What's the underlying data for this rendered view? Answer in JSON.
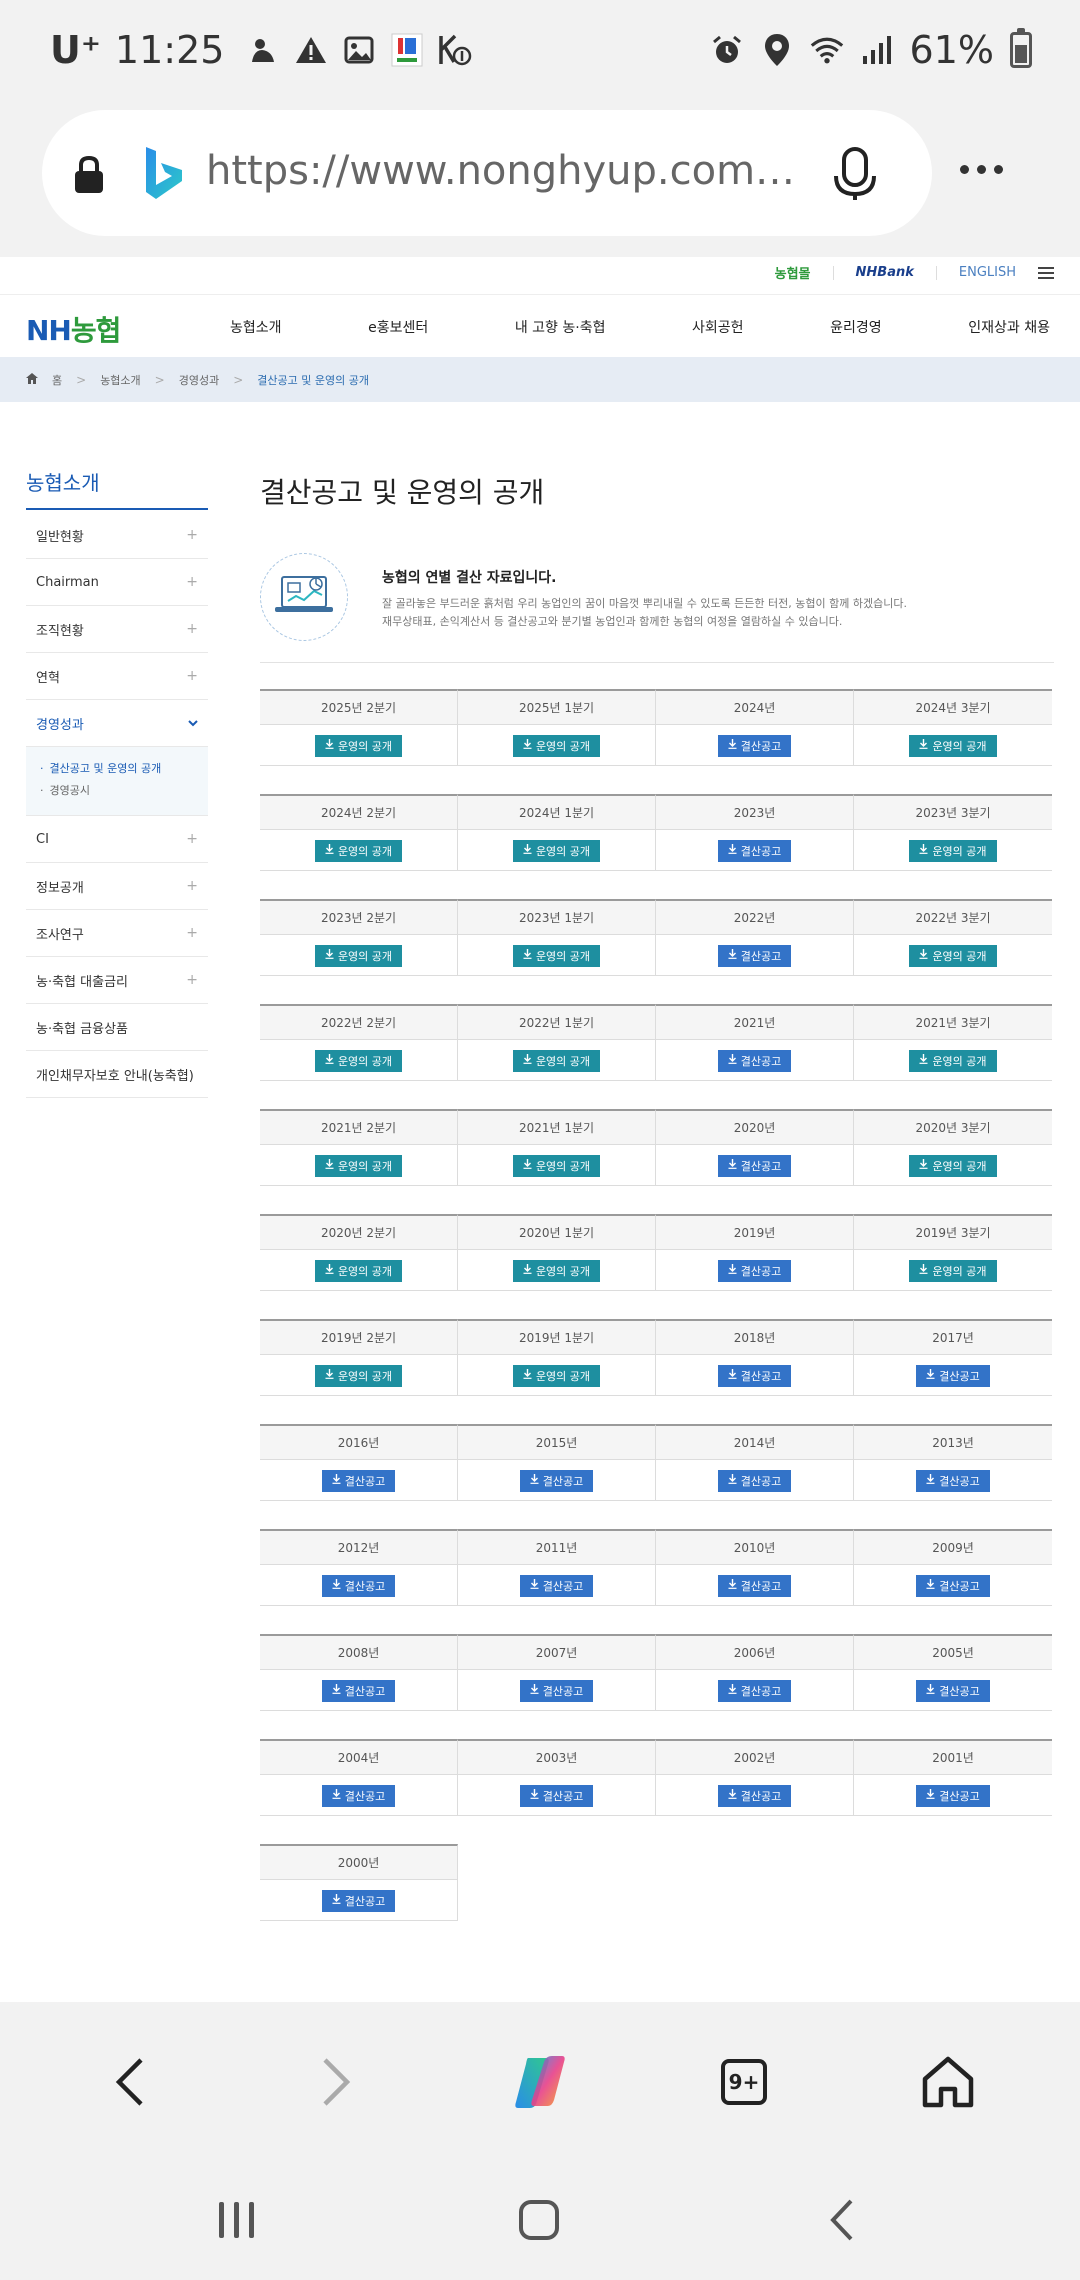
{
  "status_bar": {
    "carrier": "U⁺",
    "time": "11:25",
    "battery": "61%",
    "battery_level": 0.61
  },
  "browser": {
    "url": "https://www.nonghyup.com/intro…",
    "tabs_count": "9+"
  },
  "header": {
    "logo_nh": "NH",
    "logo_ko": "농협",
    "top_links": [
      "농협몰",
      "NHBank",
      "ENGLISH"
    ],
    "menu": [
      "농협소개",
      "e홍보센터",
      "내 고향 농·축협",
      "사회공헌",
      "윤리경영",
      "인재상과 채용"
    ]
  },
  "breadcrumb": {
    "home": "홈",
    "items": [
      "농협소개",
      "경영성과",
      "결산공고 및 운영의 공개"
    ]
  },
  "lnb": {
    "title": "농협소개",
    "items_top": [
      {
        "label": "일반현황"
      },
      {
        "label": "Chairman"
      },
      {
        "label": "조직현황"
      },
      {
        "label": "연혁"
      }
    ],
    "active": {
      "label": "경영성과"
    },
    "sub": [
      "결산공고 및 운영의 공개",
      "경영공시"
    ],
    "items_bottom": [
      {
        "label": "CI",
        "plus": true
      },
      {
        "label": "정보공개",
        "plus": true
      },
      {
        "label": "조사연구",
        "plus": true
      },
      {
        "label": "농·축협 대출금리",
        "plus": true
      },
      {
        "label": "농·축협 금융상품",
        "plus": false
      },
      {
        "label": "개인채무자보호 안내(농축협)",
        "plus": false
      }
    ]
  },
  "content": {
    "title": "결산공고 및 운영의 공개",
    "intro_heading": "농협의 연별 결산 자료입니다.",
    "intro_line1": "잘 골라놓은 부드러운 흙처럼 우리 농업인의 꿈이 마음껏 뿌리내릴 수 있도록 든든한 터전, 농협이 함께 하겠습니다.",
    "intro_line2": "재무상태표, 손익계산서 등 결산공고와 분기별 농업인과 함께한 농협의 여정을 열람하실 수 있습니다.",
    "button_labels": {
      "op": "운영의 공개",
      "gs": "결산공고"
    },
    "rows": [
      [
        {
          "label": "2025년 2분기",
          "type": "op"
        },
        {
          "label": "2025년 1분기",
          "type": "op"
        },
        {
          "label": "2024년",
          "type": "gs"
        },
        {
          "label": "2024년 3분기",
          "type": "op"
        }
      ],
      [
        {
          "label": "2024년 2분기",
          "type": "op"
        },
        {
          "label": "2024년 1분기",
          "type": "op"
        },
        {
          "label": "2023년",
          "type": "gs"
        },
        {
          "label": "2023년 3분기",
          "type": "op"
        }
      ],
      [
        {
          "label": "2023년 2분기",
          "type": "op"
        },
        {
          "label": "2023년 1분기",
          "type": "op"
        },
        {
          "label": "2022년",
          "type": "gs"
        },
        {
          "label": "2022년 3분기",
          "type": "op"
        }
      ],
      [
        {
          "label": "2022년 2분기",
          "type": "op"
        },
        {
          "label": "2022년 1분기",
          "type": "op"
        },
        {
          "label": "2021년",
          "type": "gs"
        },
        {
          "label": "2021년 3분기",
          "type": "op"
        }
      ],
      [
        {
          "label": "2021년 2분기",
          "type": "op"
        },
        {
          "label": "2021년 1분기",
          "type": "op"
        },
        {
          "label": "2020년",
          "type": "gs"
        },
        {
          "label": "2020년 3분기",
          "type": "op"
        }
      ],
      [
        {
          "label": "2020년 2분기",
          "type": "op"
        },
        {
          "label": "2020년 1분기",
          "type": "op"
        },
        {
          "label": "2019년",
          "type": "gs"
        },
        {
          "label": "2019년 3분기",
          "type": "op"
        }
      ],
      [
        {
          "label": "2019년 2분기",
          "type": "op"
        },
        {
          "label": "2019년 1분기",
          "type": "op"
        },
        {
          "label": "2018년",
          "type": "gs"
        },
        {
          "label": "2017년",
          "type": "gs"
        }
      ],
      [
        {
          "label": "2016년",
          "type": "gs"
        },
        {
          "label": "2015년",
          "type": "gs"
        },
        {
          "label": "2014년",
          "type": "gs"
        },
        {
          "label": "2013년",
          "type": "gs"
        }
      ],
      [
        {
          "label": "2012년",
          "type": "gs"
        },
        {
          "label": "2011년",
          "type": "gs"
        },
        {
          "label": "2010년",
          "type": "gs"
        },
        {
          "label": "2009년",
          "type": "gs"
        }
      ],
      [
        {
          "label": "2008년",
          "type": "gs"
        },
        {
          "label": "2007년",
          "type": "gs"
        },
        {
          "label": "2006년",
          "type": "gs"
        },
        {
          "label": "2005년",
          "type": "gs"
        }
      ],
      [
        {
          "label": "2004년",
          "type": "gs"
        },
        {
          "label": "2003년",
          "type": "gs"
        },
        {
          "label": "2002년",
          "type": "gs"
        },
        {
          "label": "2001년",
          "type": "gs"
        }
      ],
      [
        {
          "label": "2000년",
          "type": "gs"
        }
      ]
    ]
  },
  "colors": {
    "brand_blue": "#1a5bb4",
    "brand_green": "#2e9a3c",
    "btn_operation": "#1e8fa0",
    "btn_settlement": "#3373c8"
  }
}
